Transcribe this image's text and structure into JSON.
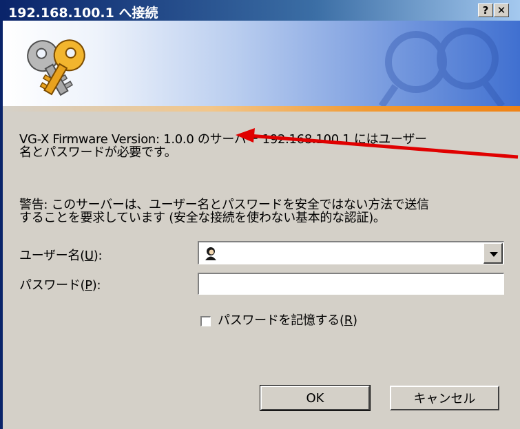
{
  "window": {
    "title": "192.168.100.1 へ接続",
    "help_button": "?",
    "close_button": "✕"
  },
  "message": {
    "line1": "VG-X Firmware Version: 1.0.0 のサーバー 192.168.100.1 にはユーザー",
    "line2": "名とパスワードが必要です。"
  },
  "warning": {
    "line1": "警告: このサーバーは、ユーザー名とパスワードを安全ではない方法で送信",
    "line2": "することを要求しています (安全な接続を使わない基本的な認証)。"
  },
  "form": {
    "username_label_pre": "ユーザー名(",
    "username_label_key": "U",
    "username_label_post": "):",
    "username_value": "",
    "password_label_pre": "パスワード(",
    "password_label_key": "P",
    "password_label_post": "):",
    "password_value": "",
    "remember_label_pre": "パスワードを記憶する(",
    "remember_label_key": "R",
    "remember_label_post": ")",
    "remember_checked": false
  },
  "buttons": {
    "ok": "OK",
    "cancel": "キャンセル"
  },
  "annotation": {
    "arrow_color": "#e00000"
  },
  "icons": {
    "banner": "keys-icon",
    "user_field": "user-icon"
  }
}
